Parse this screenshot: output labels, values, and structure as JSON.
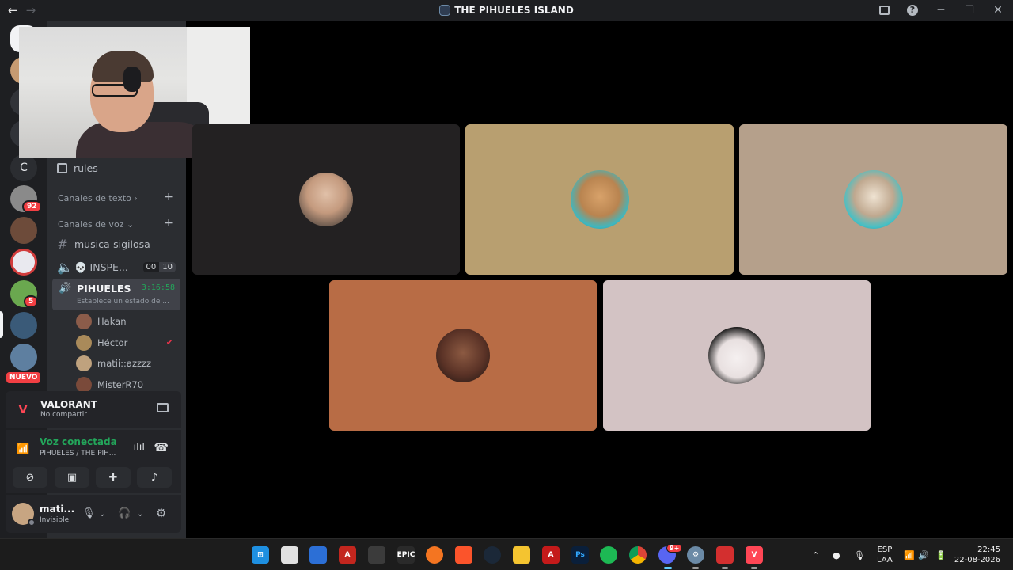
{
  "window": {
    "title": "THE PIHUELES ISLAND",
    "back_icon": "←",
    "forward_icon": "→",
    "minimize_icon": "─",
    "maximize_icon": "☐",
    "close_icon": "✕"
  },
  "rail": {
    "badge_1": "92",
    "badge_2": "5",
    "letter_server": "C",
    "new_label": "NUEVO"
  },
  "sidebar": {
    "rules_channel": "rules",
    "text_category": "Canales de texto",
    "voice_category": "Canales de voz",
    "chevron_right": "›",
    "chevron_down": "⌄",
    "plus": "+",
    "text_channel": "musica-sigilosa",
    "other_voice_channel": "💀 INSPE...",
    "other_voice_count": "00",
    "other_voice_limit": "10",
    "active_voice_channel": "PIHUELES",
    "active_voice_timer": "3:16:58",
    "active_voice_status": "Establece un estado de ...",
    "members": [
      "Hakan",
      "Héctor",
      "matii::azzzz",
      "MisterR70"
    ],
    "colors": {
      "background": "#2b2d31",
      "active_channel": "#404249",
      "green": "#23a55a"
    }
  },
  "activity": {
    "title": "VALORANT",
    "subtitle": "No compartir"
  },
  "voice": {
    "status": "Voz conectada",
    "location": "PIHUELES / THE PIH..."
  },
  "user": {
    "name": "mati...",
    "status": "Invisible"
  },
  "tiles": {
    "colors": [
      "#232122",
      "#b89f70",
      "#b5a08b",
      "#b86c45",
      "#d3c3c4"
    ]
  },
  "taskbar": {
    "language_top": "ESP",
    "language_bottom": "LAA",
    "time": "22:45",
    "date": "22-08-2026",
    "discord_badge": "9+"
  }
}
